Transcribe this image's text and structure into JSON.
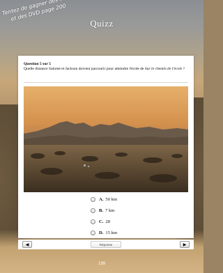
{
  "header": {
    "promo_line1": "Tentez de gagner des livres",
    "promo_line2": "et des DVD page 200",
    "title": "Quizz"
  },
  "question": {
    "number_label": "Question 5 sur 5",
    "text_prefix": "Quelle distance Salomé et Jackson doivent parcourir pour atteindre l'école de ",
    "text_italic": "Sur le chemin de l'école",
    "text_suffix": " ?"
  },
  "options": [
    {
      "letter": "A.",
      "text": "50 km"
    },
    {
      "letter": "B.",
      "text": "7 km"
    },
    {
      "letter": "C.",
      "text": "28"
    },
    {
      "letter": "D.",
      "text": "15 km"
    }
  ],
  "navigation": {
    "prev_icon": "◀",
    "next_icon": "▶",
    "answer_label": "Réponse"
  },
  "footer": {
    "page_number": "199"
  },
  "colors": {
    "panel_bg": "#ffffff",
    "title_text": "#ffffff",
    "sky_top": "#e0a862"
  }
}
